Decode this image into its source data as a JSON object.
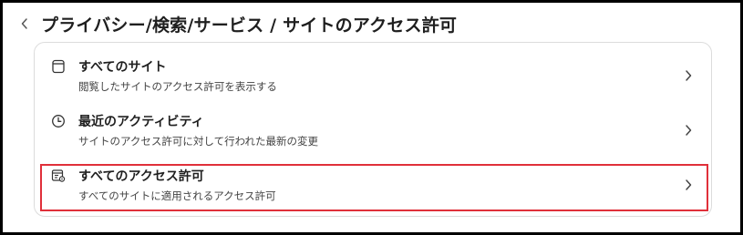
{
  "header": {
    "title": "プライバシー/検索/サービス / サイトのアクセス許可",
    "back_icon": "chevron-left-icon"
  },
  "list": {
    "items": [
      {
        "title": "すべてのサイト",
        "description": "閲覧したサイトのアクセス許可を表示する",
        "icon": "browser-window-icon"
      },
      {
        "title": "最近のアクティビティ",
        "description": "サイトのアクセス許可に対して行われた最新の変更",
        "icon": "clock-icon"
      },
      {
        "title": "すべてのアクセス許可",
        "description": "すべてのサイトに適用されるアクセス許可",
        "icon": "list-settings-icon"
      }
    ],
    "chevron_icon": "chevron-right-icon"
  },
  "colors": {
    "highlight_border": "#e0303a",
    "frame_border": "#000000",
    "card_border": "#dcdcdc"
  }
}
